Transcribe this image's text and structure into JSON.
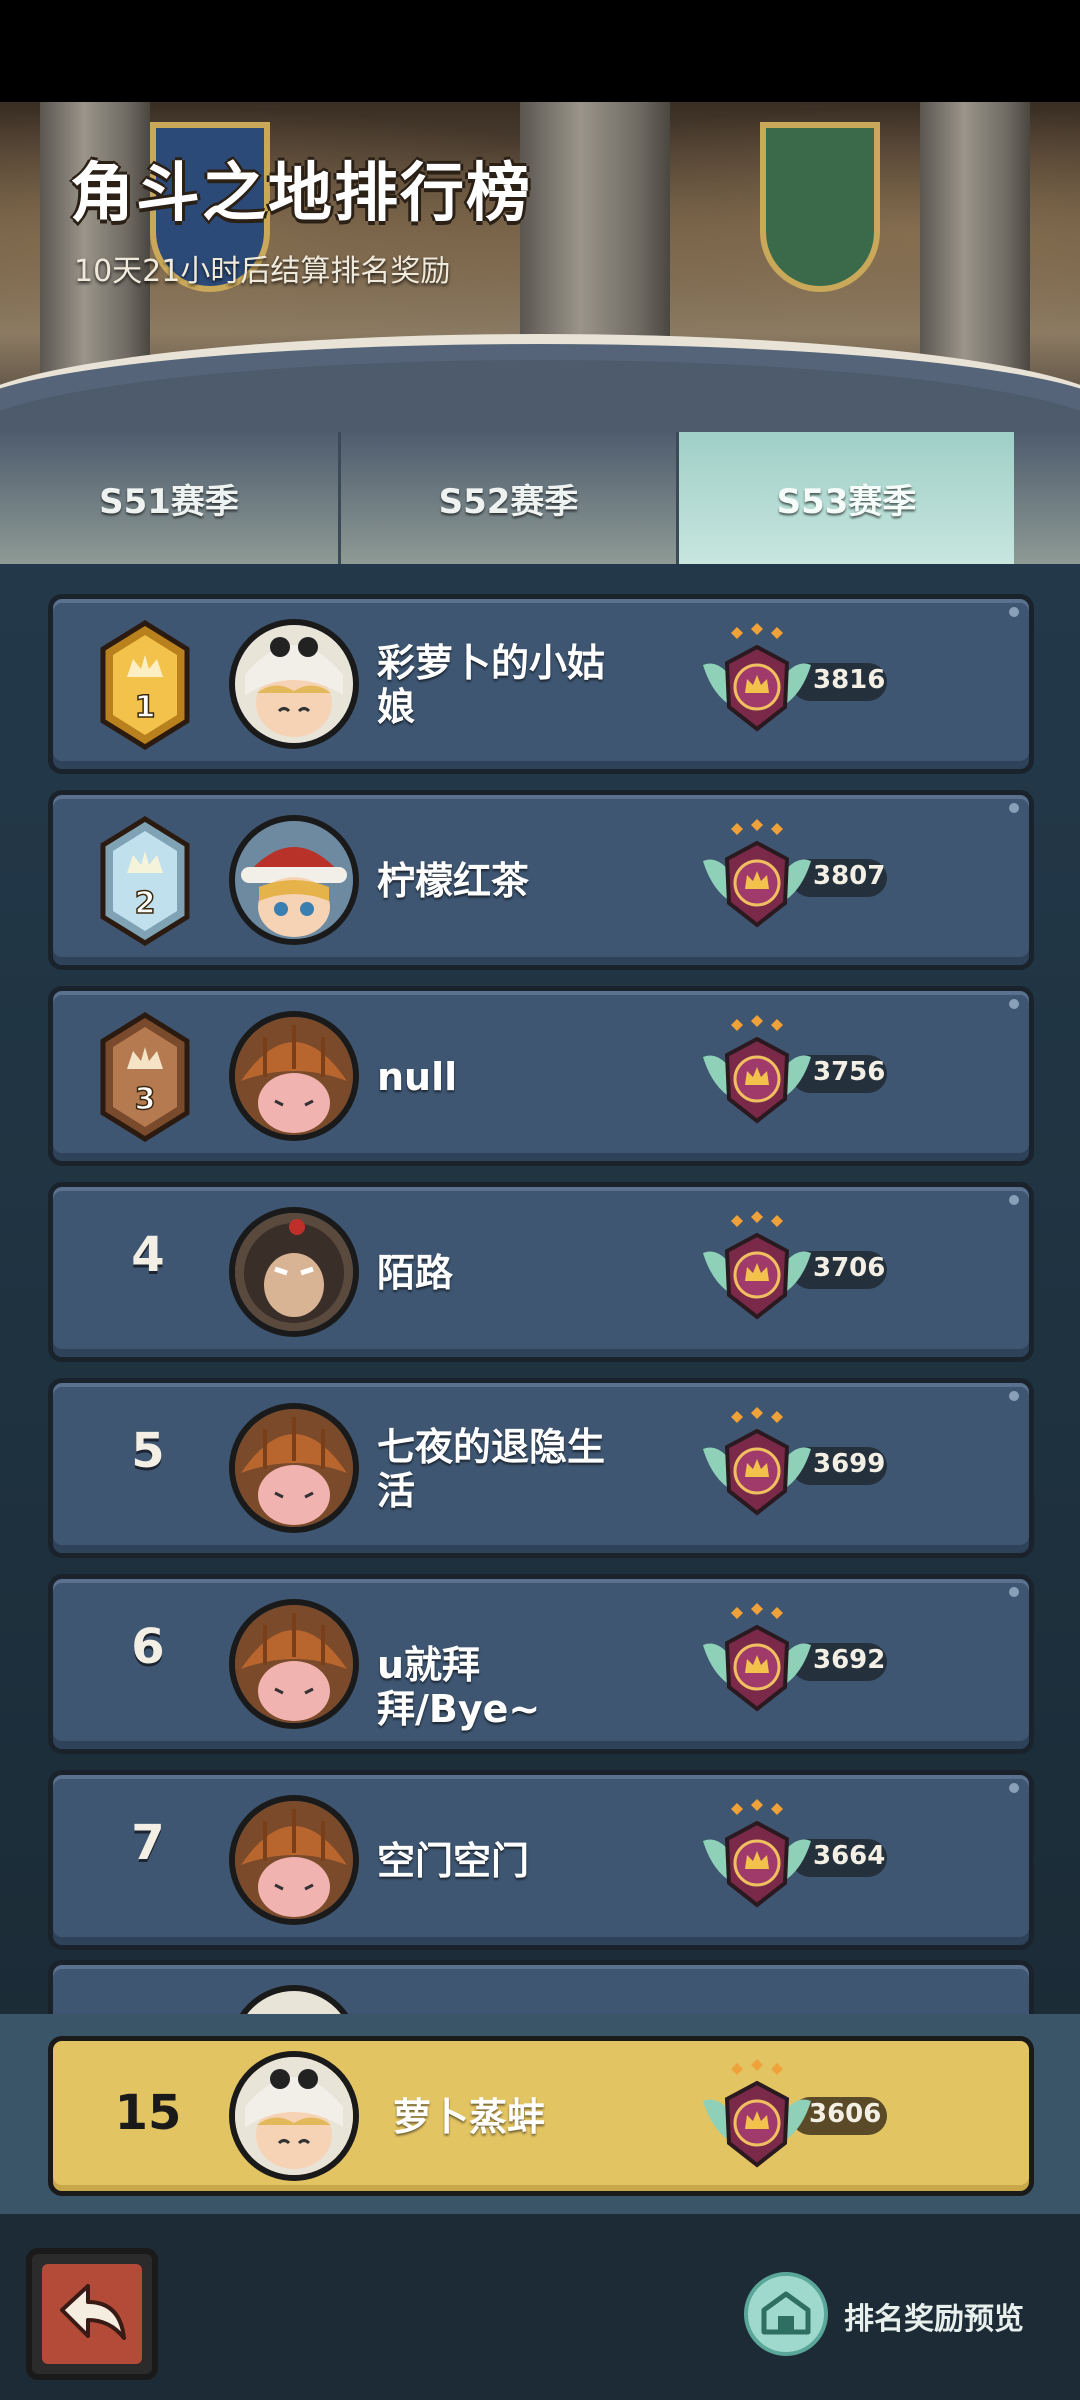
{
  "header": {
    "title": "角斗之地排行榜",
    "subtitle": "10天21小时后结算排名奖励"
  },
  "tabs": [
    {
      "label": "S51赛季",
      "active": false
    },
    {
      "label": "S52赛季",
      "active": false
    },
    {
      "label": "S53赛季",
      "active": true
    }
  ],
  "rows": [
    {
      "rank": "1",
      "name": "彩萝卜的小姑娘",
      "score": "3816",
      "avatar": "white-hood-avatar",
      "rank_style": "gold"
    },
    {
      "rank": "2",
      "name": "柠檬红茶",
      "score": "3807",
      "avatar": "red-hat-avatar",
      "rank_style": "silver"
    },
    {
      "rank": "3",
      "name": "null",
      "score": "3756",
      "avatar": "pumpkin-hood-avatar",
      "rank_style": "bronze"
    },
    {
      "rank": "4",
      "name": "陌路",
      "score": "3706",
      "avatar": "monkey-avatar",
      "rank_style": "plain"
    },
    {
      "rank": "5",
      "name": "七夜的退隐生活",
      "score": "3699",
      "avatar": "pumpkin-hood-avatar",
      "rank_style": "plain"
    },
    {
      "rank": "6",
      "name": "u就拜拜/Bye~",
      "score": "3692",
      "avatar": "pumpkin-hood-avatar",
      "rank_style": "plain"
    },
    {
      "rank": "7",
      "name": "空门空门",
      "score": "3664",
      "avatar": "pumpkin-hood-avatar",
      "rank_style": "plain"
    }
  ],
  "my_rank": {
    "rank": "15",
    "name": "萝卜蒸蚌",
    "score": "3606",
    "avatar": "white-hood-avatar"
  },
  "footer": {
    "back_icon": "back-arrow-icon",
    "reward_preview_label": "排名奖励预览"
  },
  "colors": {
    "row_bg": "#3e5672",
    "my_row_bg": "#e3c463",
    "active_tab": "#b9ded6",
    "gold": "#e9b73e",
    "silver": "#a9c7d6",
    "bronze": "#a06a45"
  }
}
